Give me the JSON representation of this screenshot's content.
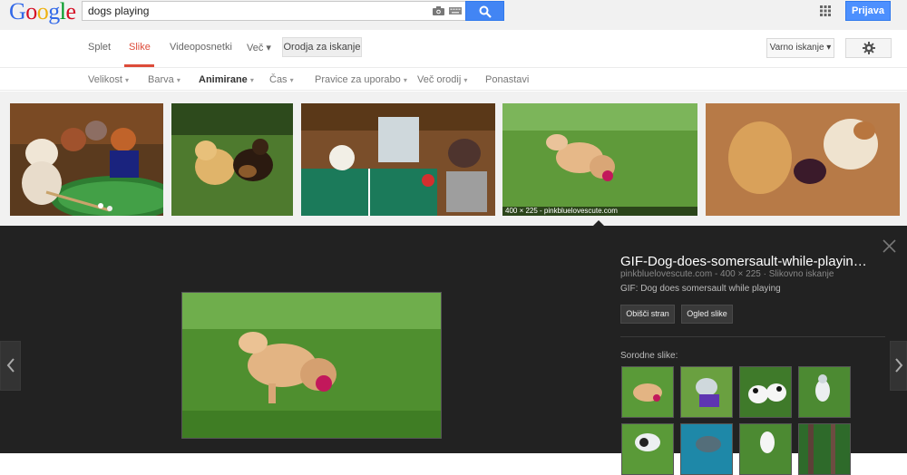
{
  "header": {
    "logo_letters": [
      "G",
      "o",
      "o",
      "g",
      "l",
      "e"
    ],
    "search_query": "dogs playing",
    "signin_label": "Prijava",
    "icons": [
      "camera-icon",
      "keyboard-icon",
      "search-icon",
      "apps-grid-icon"
    ]
  },
  "nav": {
    "tabs": [
      {
        "label": "Splet"
      },
      {
        "label": "Slike",
        "active": true
      },
      {
        "label": "Videoposnetki"
      },
      {
        "label": "Več ▾"
      }
    ],
    "tools_button": "Orodja za iskanje",
    "safesearch_label": "Varno iskanje ▾",
    "settings_icon": "gear-icon",
    "accent_color": "#dd4b39"
  },
  "toolsbar": {
    "items": [
      {
        "label": "Velikost",
        "caret": "▾"
      },
      {
        "label": "Barva",
        "caret": "▾"
      },
      {
        "label": "Animirane",
        "caret": "▾",
        "bold": true
      },
      {
        "label": "Čas",
        "caret": "▾"
      },
      {
        "label": "Pravice za uporabo",
        "caret": "▾"
      },
      {
        "label": "Več orodij",
        "caret": "▾"
      },
      {
        "label": "Ponastavi",
        "caret": ""
      }
    ]
  },
  "results": {
    "selected_caption": "400 × 225 - pinkbluelovescute.com"
  },
  "viewer": {
    "title": "GIF-Dog-does-somersault-while-playin…",
    "source": "pinkbluelovescute.com - 400 × 225 · Slikovno iskanje",
    "description": "GIF: Dog does somersault while playing",
    "visit_button": "Obišči stran",
    "view_button": "Ogled slike",
    "related_label": "Sorodne slike:",
    "close_icon": "close-icon",
    "prev_icon": "chevron-left-icon",
    "next_icon": "chevron-right-icon"
  }
}
